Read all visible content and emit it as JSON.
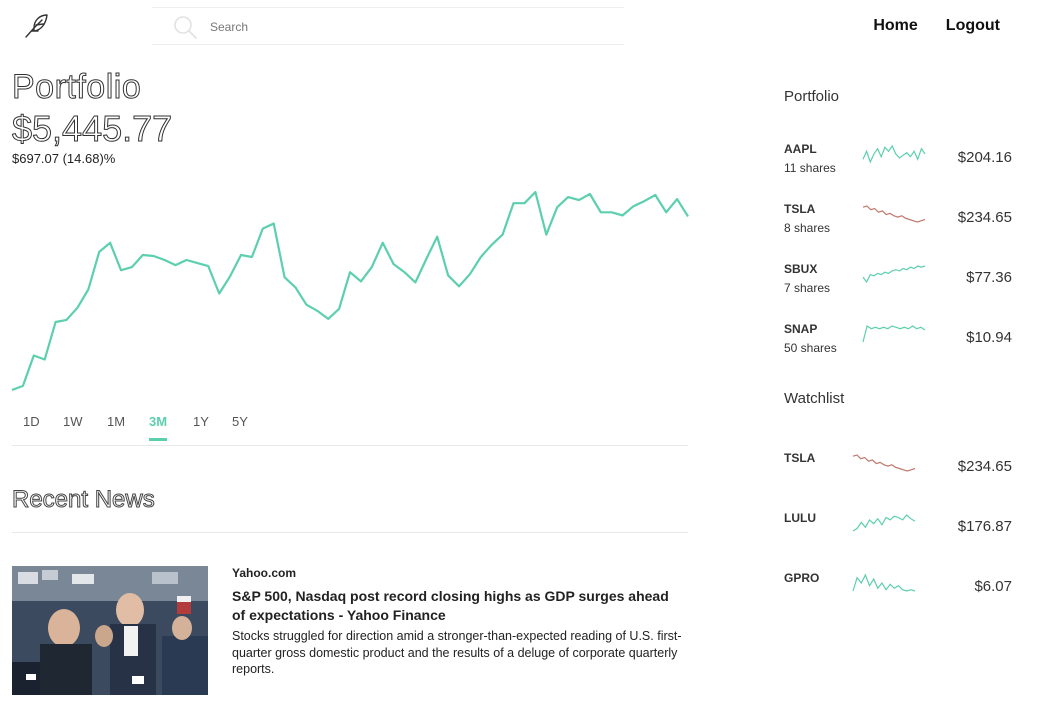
{
  "header": {
    "search": {
      "placeholder": "Search"
    },
    "nav": {
      "home": "Home",
      "logout": "Logout"
    }
  },
  "portfolio": {
    "title": "Portfolio",
    "value": "$5,445.77",
    "change": "$697.07 (14.68)%"
  },
  "chart_data": {
    "type": "line",
    "color": "#5ccfae",
    "values": [
      12,
      16,
      46,
      42,
      79,
      81,
      93,
      111,
      148,
      157,
      130,
      133,
      145,
      144,
      140,
      135,
      140,
      137,
      134,
      107,
      124,
      145,
      143,
      171,
      176,
      123,
      113,
      96,
      90,
      82,
      92,
      128,
      119,
      133,
      157,
      136,
      128,
      118,
      141,
      163,
      125,
      114,
      126,
      143,
      155,
      165,
      196,
      196,
      207,
      165,
      192,
      202,
      199,
      205,
      187,
      187,
      184,
      193,
      198,
      204,
      187,
      200,
      183
    ]
  },
  "ranges": [
    "1D",
    "1W",
    "1M",
    "3M",
    "1Y",
    "5Y"
  ],
  "active_range": "3M",
  "news": {
    "title": "Recent News",
    "items": [
      {
        "source": "Yahoo.com",
        "headline": "S&P 500, Nasdaq post record closing highs as GDP surges ahead of expectations - Yahoo Finance",
        "summary": "Stocks struggled for direction amid a stronger-than-expected reading of U.S. first-quarter gross domestic product and the results of a deluge of corporate quarterly reports."
      }
    ]
  },
  "sidebar": {
    "portfolio_title": "Portfolio",
    "watchlist_title": "Watchlist",
    "portfolio_items": [
      {
        "symbol": "AAPL",
        "shares": "11 shares",
        "price": "$204.16",
        "trend": "up",
        "spark": [
          6,
          12,
          4,
          10,
          14,
          8,
          15,
          12,
          16,
          10,
          7,
          9,
          11,
          8,
          12,
          6,
          14,
          10
        ]
      },
      {
        "symbol": "TSLA",
        "shares": "8 shares",
        "price": "$234.65",
        "trend": "down",
        "spark": [
          16,
          17,
          14,
          15,
          12,
          13,
          10,
          11,
          9,
          8,
          9,
          7,
          6,
          5,
          4,
          5,
          6
        ]
      },
      {
        "symbol": "SBUX",
        "shares": "7 shares",
        "price": "$77.36",
        "trend": "up",
        "spark": [
          6,
          2,
          8,
          7,
          9,
          8,
          10,
          9,
          11,
          12,
          11,
          13,
          12,
          14,
          13,
          15,
          14,
          15
        ]
      },
      {
        "symbol": "SNAP",
        "shares": "50 shares",
        "price": "$10.94",
        "trend": "up",
        "spark": [
          2,
          14,
          12,
          13,
          12,
          13,
          12,
          14,
          13,
          12,
          13,
          12,
          14,
          12,
          13,
          11
        ]
      }
    ],
    "watchlist_items": [
      {
        "symbol": "TSLA",
        "price": "$234.65",
        "trend": "down",
        "spark": [
          16,
          17,
          14,
          15,
          12,
          13,
          10,
          11,
          9,
          8,
          9,
          7,
          6,
          5,
          4,
          5,
          6
        ]
      },
      {
        "symbol": "LULU",
        "price": "$176.87",
        "trend": "up",
        "spark": [
          3,
          5,
          10,
          6,
          12,
          9,
          13,
          8,
          14,
          12,
          15,
          14,
          12,
          16,
          13,
          11
        ]
      },
      {
        "symbol": "GPRO",
        "price": "$6.07",
        "trend": "up",
        "spark": [
          4,
          14,
          10,
          16,
          8,
          13,
          6,
          10,
          5,
          9,
          6,
          8,
          5,
          4,
          5,
          4
        ]
      }
    ]
  },
  "colors": {
    "accent": "#5ccfae",
    "up": "#5ccfae",
    "down": "#c0786c"
  }
}
